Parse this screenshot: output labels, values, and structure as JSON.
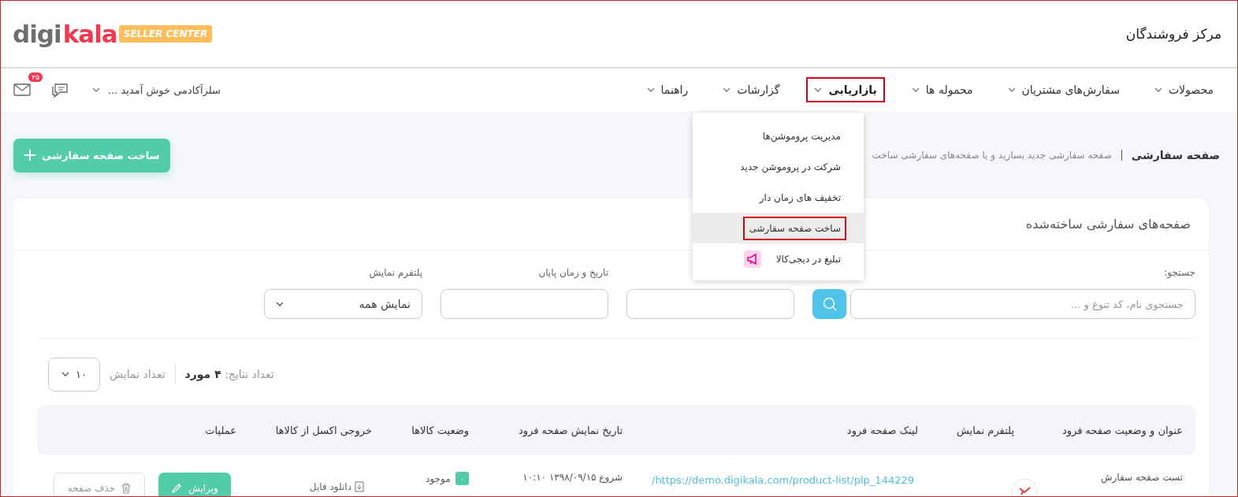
{
  "header": {
    "logo": {
      "part_1": "digi",
      "part_2": "kala",
      "badge": "SELLER CENTER"
    },
    "title": "مرکز فروشندگان"
  },
  "nav": {
    "items": [
      {
        "label": "محصولات",
        "selected": false,
        "highlighted": false
      },
      {
        "label": "سفارش‌های مشتریان",
        "selected": false,
        "highlighted": false
      },
      {
        "label": "محموله ها",
        "selected": false,
        "highlighted": false
      },
      {
        "label": "بازاریابی",
        "selected": true,
        "highlighted": true
      },
      {
        "label": "گزارشات",
        "selected": false,
        "highlighted": false
      },
      {
        "label": "راهنما",
        "selected": false,
        "highlighted": false
      }
    ],
    "user": "سلرآکادمی خوش آمدید ...",
    "mail_badge": "۲۵"
  },
  "page": {
    "breadcrumb_title": "صفحه سفارشی",
    "breadcrumb_description": "صفحه سفارشی جدید بسازید و یا صفحه‌های سفارشی ساخت",
    "create_button": "ساخت صفحه سفارشی"
  },
  "dropdown": {
    "items": [
      {
        "label": "مدیریت پروموشن‌ها",
        "kind": "text",
        "selected": false,
        "highlighted": false
      },
      {
        "label": "شرکت در پروموشن جدید",
        "kind": "text",
        "selected": false,
        "highlighted": false
      },
      {
        "label": "تخفیف های زمان دار",
        "kind": "text",
        "selected": false,
        "highlighted": false
      },
      {
        "label": "ساخت صفحه سفارشی",
        "kind": "text",
        "selected": true,
        "highlighted": true
      },
      {
        "label": "تبلیغ در دیجی‌کالا",
        "kind": "icon",
        "selected": false,
        "highlighted": false
      }
    ]
  },
  "card": {
    "title": "صفحه‌های سفارشی ساخته‌شده",
    "filters": [
      {
        "kind": "search",
        "label": "جستجو:",
        "placeholder": "جستجوی نام، کد تنوع و ..."
      },
      {
        "kind": "date"
      },
      {
        "kind": "date",
        "label": "تاریخ و زمان پایان"
      },
      {
        "kind": "select",
        "label": "پلتفرم نمایش",
        "value": "نمایش همه"
      }
    ],
    "results": "تعداد نتایج: **۴ مورد**",
    "page_size_label": "تعداد نمایش",
    "page_size": "۱۰"
  },
  "table": {
    "columns": [
      "عنوان و وضعیت صفحه فرود",
      "پلتفرم نمایش",
      "لینک صفحه فرود",
      "تاریخ نمایش صفحه فرود",
      "وضعیت کالاها",
      "خروجی اکسل از کالاها",
      "عملیات"
    ],
    "rows": [
      {
        "title": "تست صفحه سفارش",
        "link": "https://demo.digikala.com/product-list/plp_144229/",
        "date": "شروع ۱۳۹۸/۰۹/۱۵ ۱۰:۱۰",
        "stock_count": "۰",
        "stock_label": "موجود",
        "download": "دانلود فایل",
        "edit": "ویرایش",
        "delete": "حذف صفحه"
      }
    ]
  }
}
